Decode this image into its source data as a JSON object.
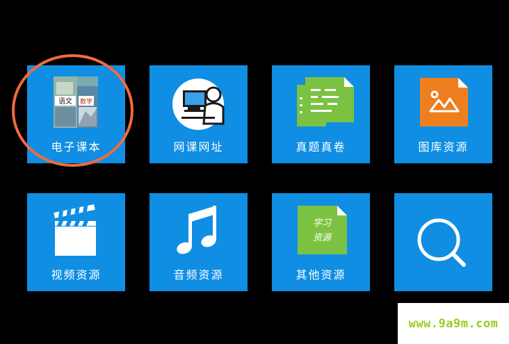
{
  "colors": {
    "background": "#000000",
    "tile": "#0f8ee3",
    "highlight": "#f26b3a",
    "image_orange": "#ee7f1e",
    "doc_green": "#7cc242",
    "watermark_text": "#9acd1a"
  },
  "tiles": [
    {
      "label": "电子课本",
      "icon": "textbook-icon",
      "highlighted": true
    },
    {
      "label": "网课网址",
      "icon": "online-class-icon"
    },
    {
      "label": "真题真卷",
      "icon": "exam-papers-icon"
    },
    {
      "label": "图库资源",
      "icon": "image-library-icon"
    },
    {
      "label": "视频资源",
      "icon": "clapperboard-icon"
    },
    {
      "label": "音频资源",
      "icon": "music-note-icon"
    },
    {
      "label": "其他资源",
      "icon": "study-resource-doc-icon",
      "doc_text": [
        "学习",
        "资源"
      ]
    },
    {
      "label": "",
      "icon": "search-icon"
    }
  ],
  "textbook_icon_text": [
    "语文",
    "数学"
  ],
  "watermark": "www.9a9m.com"
}
